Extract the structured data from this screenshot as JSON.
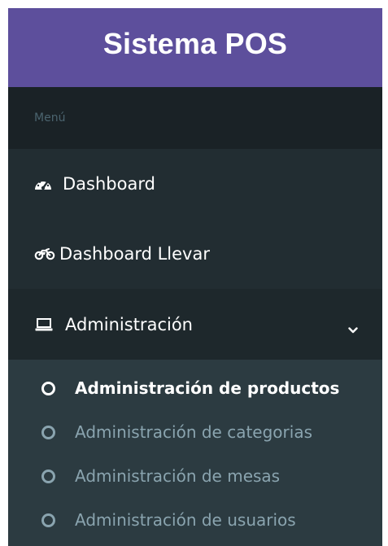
{
  "brand": {
    "title": "Sistema POS"
  },
  "menu": {
    "header": "Menú",
    "items": [
      {
        "label": "Dashboard",
        "icon": "tachometer-icon"
      },
      {
        "label": "Dashboard Llevar",
        "icon": "motorcycle-icon"
      },
      {
        "label": "Administración",
        "icon": "laptop-icon",
        "expanded": true
      }
    ],
    "submenu": [
      {
        "label": "Administración de productos",
        "active": true
      },
      {
        "label": "Administración de categorias",
        "active": false
      },
      {
        "label": "Administración de mesas",
        "active": false
      },
      {
        "label": "Administración de usuarios",
        "active": false
      }
    ]
  },
  "colors": {
    "brand": "#5d4f9c",
    "sidebar": "#222d32",
    "header": "#1a2226",
    "submenu": "#2c3b41",
    "muted_text": "#8aa4af"
  }
}
